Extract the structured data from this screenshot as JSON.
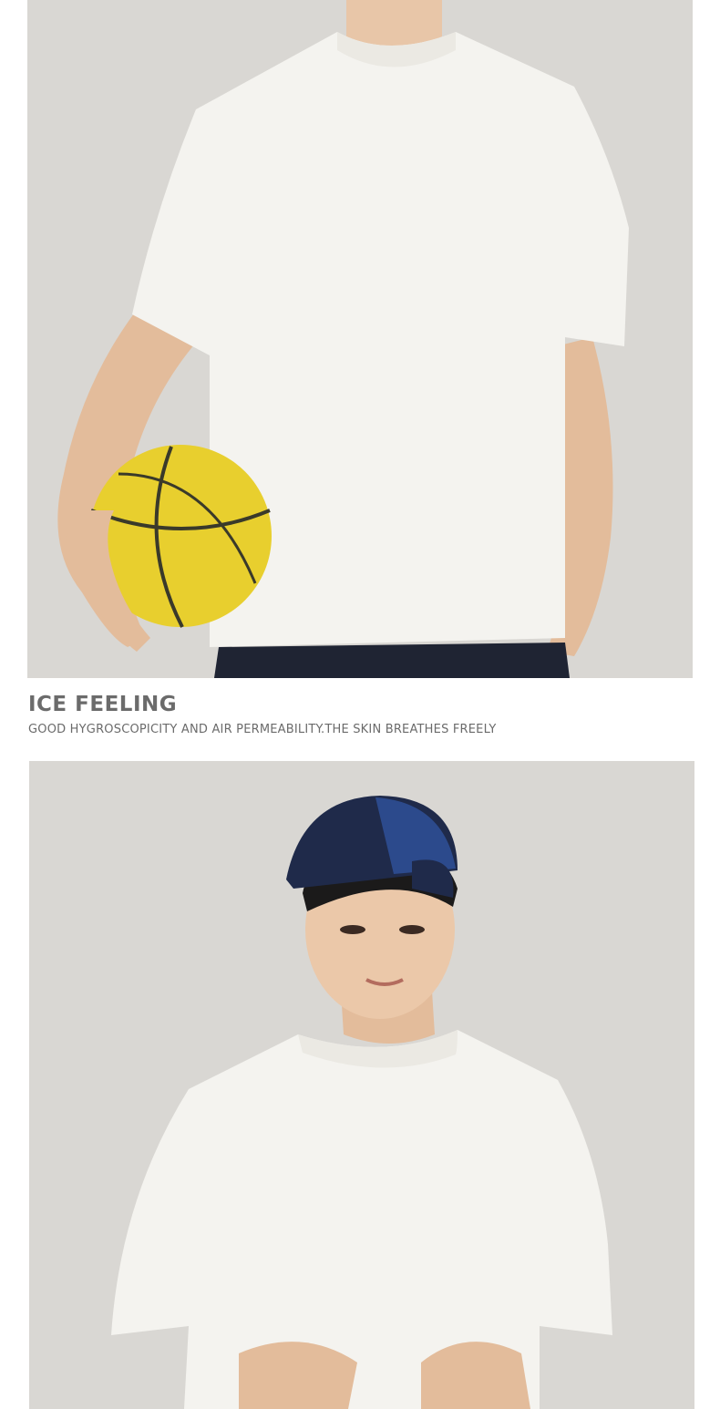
{
  "section1": {
    "photo": "model-holding-basketball",
    "basketball_color": "#e8cf2e"
  },
  "caption": {
    "title": "ICE FEELING",
    "subtitle": "GOOD HYGROSCOPICITY AND AIR PERMEABILITY.THE SKIN BREATHES FREELY"
  },
  "section2": {
    "photo": "model-in-blue-cap",
    "cap_color": "#2c4a8c"
  },
  "colors": {
    "background": "#ffffff",
    "photo_backdrop": "#d9d7d3",
    "caption_text": "#6b6b6b",
    "shirt": "#f4f3ef"
  }
}
